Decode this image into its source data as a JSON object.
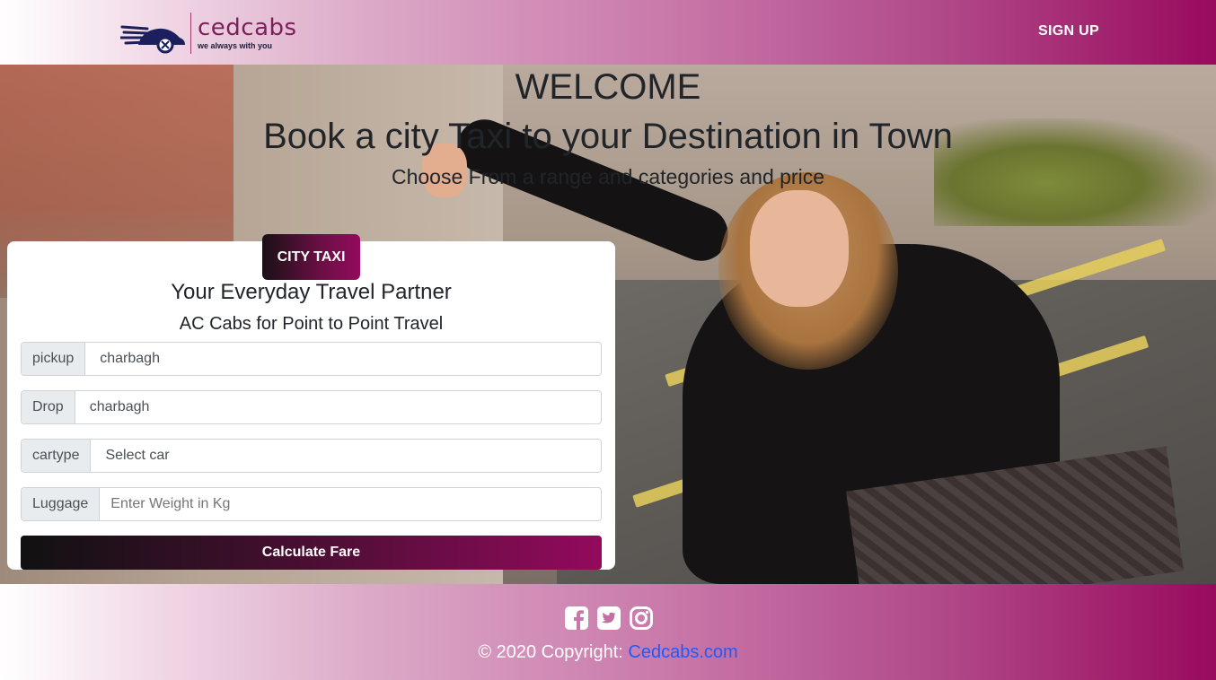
{
  "header": {
    "brand_name": "cedcabs",
    "brand_tagline": "we always with you",
    "signup_label": "SIGN UP"
  },
  "hero": {
    "welcome": "WELCOME",
    "headline": "Book a city Taxi to your Destination in Town",
    "subline": "Choose From a range and categories and price"
  },
  "booking": {
    "badge": "CITY TAXI",
    "title": "Your Everyday Travel Partner",
    "subtitle": "AC Cabs for Point to Point Travel",
    "fields": [
      {
        "label": "pickup",
        "value": "charbagh"
      },
      {
        "label": "Drop",
        "value": "charbagh"
      },
      {
        "label": "cartype",
        "value": "Select car"
      },
      {
        "label": "Luggage",
        "placeholder": "Enter Weight in Kg"
      }
    ],
    "submit_label": "Calculate Fare"
  },
  "footer": {
    "icons": [
      "facebook-icon",
      "twitter-icon",
      "instagram-icon"
    ],
    "copyright_prefix": "© 2020 Copyright: ",
    "copyright_link": "Cedcabs.com"
  },
  "colors": {
    "brand": "#930a5d",
    "link": "#1a5cff"
  }
}
